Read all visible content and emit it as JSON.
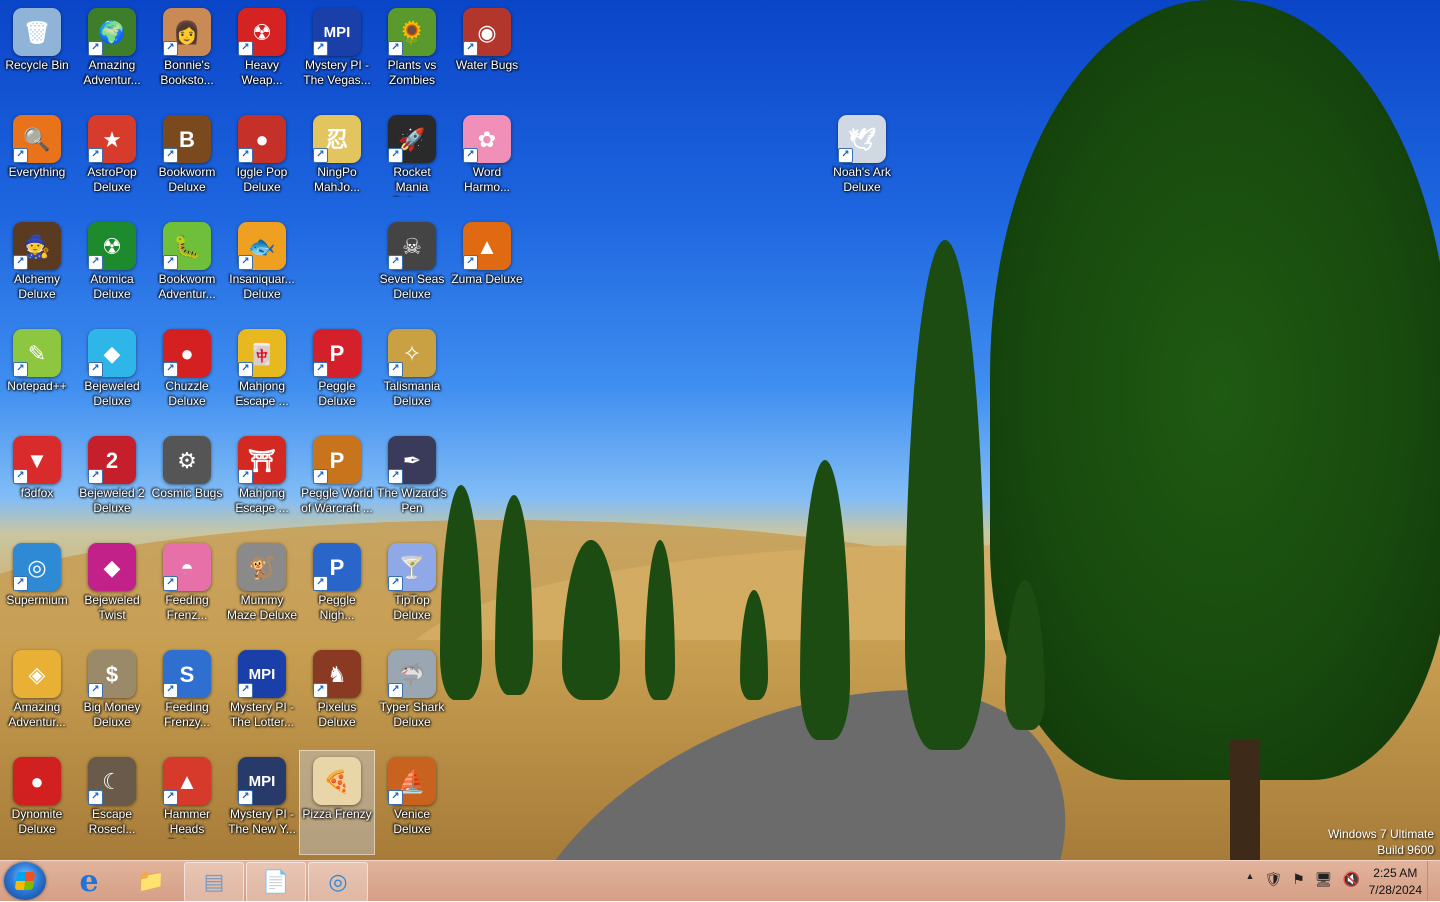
{
  "desktop": {
    "icons": [
      {
        "label": "Recycle Bin",
        "name": "recycle-bin-icon",
        "glyph": "🗑",
        "color": "#8fb4d8",
        "shortcut": false
      },
      {
        "label": "Amazing Adventur...",
        "name": "amazing-adventures-icon",
        "glyph": "🌍",
        "color": "#3e7d2a",
        "shortcut": true
      },
      {
        "label": "Bonnie's Booksto...",
        "name": "bonnies-bookstore-icon",
        "glyph": "👩",
        "color": "#c98a55",
        "shortcut": true
      },
      {
        "label": "Heavy Weap...",
        "name": "heavy-weapon-icon",
        "glyph": "☢",
        "color": "#d52222",
        "shortcut": true
      },
      {
        "label": "Mystery PI - The Vegas...",
        "name": "mystery-pi-vegas-icon",
        "glyph": "MPI",
        "color": "#1b3fa8",
        "shortcut": true
      },
      {
        "label": "Plants vs Zombies",
        "name": "plants-vs-zombies-icon",
        "glyph": "🌻",
        "color": "#5a9a2c",
        "shortcut": true
      },
      {
        "label": "Water Bugs",
        "name": "water-bugs-icon",
        "glyph": "◉",
        "color": "#b3362c",
        "shortcut": true
      },
      {
        "label": "Everything",
        "name": "everything-icon",
        "glyph": "🔍",
        "color": "#e8731a",
        "shortcut": true
      },
      {
        "label": "AstroPop Deluxe",
        "name": "astropop-deluxe-icon",
        "glyph": "★",
        "color": "#d63b2b",
        "shortcut": true
      },
      {
        "label": "Bookworm Deluxe",
        "name": "bookworm-deluxe-icon",
        "glyph": "B",
        "color": "#7a4a1e",
        "shortcut": true
      },
      {
        "label": "Iggle Pop Deluxe",
        "name": "iggle-pop-deluxe-icon",
        "glyph": "●",
        "color": "#c53028",
        "shortcut": true
      },
      {
        "label": "NingPo MahJo...",
        "name": "ningpo-mahjong-icon",
        "glyph": "忍",
        "color": "#e3c560",
        "shortcut": true
      },
      {
        "label": "Rocket Mania Deluxe",
        "name": "rocket-mania-deluxe-icon",
        "glyph": "🚀",
        "color": "#2a2a2a",
        "shortcut": true
      },
      {
        "label": "Word Harmo...",
        "name": "word-harmony-icon",
        "glyph": "✿",
        "color": "#f08fb8",
        "shortcut": true
      },
      {
        "label": "Alchemy Deluxe",
        "name": "alchemy-deluxe-icon",
        "glyph": "🧙",
        "color": "#5b3a22",
        "shortcut": true
      },
      {
        "label": "Atomica Deluxe",
        "name": "atomica-deluxe-icon",
        "glyph": "☢",
        "color": "#1d8a2e",
        "shortcut": true
      },
      {
        "label": "Bookworm Adventur...",
        "name": "bookworm-adventures-icon",
        "glyph": "🐛",
        "color": "#6fbf3a",
        "shortcut": true
      },
      {
        "label": "Insaniquar... Deluxe",
        "name": "insaniquarium-deluxe-icon",
        "glyph": "🐟",
        "color": "#f0a020",
        "shortcut": true
      },
      {
        "label": "Seven Seas Deluxe",
        "name": "seven-seas-deluxe-icon",
        "glyph": "☠",
        "color": "#444444",
        "shortcut": true
      },
      {
        "label": "Zuma Deluxe",
        "name": "zuma-deluxe-icon",
        "glyph": "▲",
        "color": "#e06a12",
        "shortcut": true
      },
      {
        "label": "Notepad++",
        "name": "notepad-plus-plus-icon",
        "glyph": "✎",
        "color": "#8dc63f",
        "shortcut": true
      },
      {
        "label": "Bejeweled Deluxe",
        "name": "bejeweled-deluxe-icon",
        "glyph": "◆",
        "color": "#2fb6e8",
        "shortcut": true
      },
      {
        "label": "Chuzzle Deluxe",
        "name": "chuzzle-deluxe-icon",
        "glyph": "●",
        "color": "#d42020",
        "shortcut": true
      },
      {
        "label": "Mahjong Escape ...",
        "name": "mahjong-escape-icon-1",
        "glyph": "🀄",
        "color": "#e8b820",
        "shortcut": true
      },
      {
        "label": "Peggle Deluxe",
        "name": "peggle-deluxe-icon",
        "glyph": "P",
        "color": "#d4202a",
        "shortcut": true
      },
      {
        "label": "Talismania Deluxe",
        "name": "talismania-deluxe-icon",
        "glyph": "✧",
        "color": "#c9a042",
        "shortcut": true
      },
      {
        "label": "f3dfox",
        "name": "f3dfox-icon",
        "glyph": "▼",
        "color": "#d92b2b",
        "shortcut": true
      },
      {
        "label": "Bejeweled 2 Deluxe",
        "name": "bejeweled-2-deluxe-icon",
        "glyph": "2",
        "color": "#c41f2a",
        "shortcut": true
      },
      {
        "label": "Cosmic Bugs",
        "name": "cosmic-bugs-icon",
        "glyph": "⚙",
        "color": "#555555",
        "shortcut": false
      },
      {
        "label": "Mahjong Escape ...",
        "name": "mahjong-escape-icon-2",
        "glyph": "⛩",
        "color": "#d22a22",
        "shortcut": true
      },
      {
        "label": "Peggle World of Warcraft ...",
        "name": "peggle-wow-icon",
        "glyph": "P",
        "color": "#c7741c",
        "shortcut": true
      },
      {
        "label": "The Wizard's Pen",
        "name": "wizards-pen-icon",
        "glyph": "✒",
        "color": "#3a3a5a",
        "shortcut": true
      },
      {
        "label": "Supermium",
        "name": "supermium-icon",
        "glyph": "◎",
        "color": "#2f8ad6",
        "shortcut": true
      },
      {
        "label": "Bejeweled Twist",
        "name": "bejeweled-twist-icon",
        "glyph": "◆",
        "color": "#c3218a",
        "shortcut": false
      },
      {
        "label": "Feeding Frenz...",
        "name": "feeding-frenzy-icon",
        "glyph": "◓",
        "color": "#e870a8",
        "shortcut": true
      },
      {
        "label": "Mummy Maze Deluxe",
        "name": "mummy-maze-deluxe-icon",
        "glyph": "🐒",
        "color": "#8a8a8a",
        "shortcut": false
      },
      {
        "label": "Peggle Nigh...",
        "name": "peggle-nights-icon",
        "glyph": "P",
        "color": "#2a66c9",
        "shortcut": true
      },
      {
        "label": "TipTop Deluxe",
        "name": "tiptop-deluxe-icon",
        "glyph": "🍸",
        "color": "#8fa8e8",
        "shortcut": true
      },
      {
        "label": "Amazing Adventur...",
        "name": "amazing-adventures-2-icon",
        "glyph": "◈",
        "color": "#e8b035",
        "shortcut": false
      },
      {
        "label": "Big Money Deluxe",
        "name": "big-money-deluxe-icon",
        "glyph": "$",
        "color": "#9b8a6a",
        "shortcut": true
      },
      {
        "label": "Feeding Frenzy...",
        "name": "feeding-frenzy-2-icon",
        "glyph": "S",
        "color": "#2f6fd0",
        "shortcut": true
      },
      {
        "label": "Mystery PI - The Lotter...",
        "name": "mystery-pi-lottery-icon",
        "glyph": "MPI",
        "color": "#1b3fa8",
        "shortcut": true
      },
      {
        "label": "Pixelus Deluxe",
        "name": "pixelus-deluxe-icon",
        "glyph": "♞",
        "color": "#8a3a22",
        "shortcut": true
      },
      {
        "label": "Typer Shark Deluxe",
        "name": "typer-shark-deluxe-icon",
        "glyph": "🦈",
        "color": "#9aa7b3",
        "shortcut": true
      },
      {
        "label": "Dynomite Deluxe",
        "name": "dynomite-deluxe-icon",
        "glyph": "●",
        "color": "#d21f1f",
        "shortcut": false
      },
      {
        "label": "Escape Rosecl...",
        "name": "escape-rosecliff-icon",
        "glyph": "☾",
        "color": "#6a5a4a",
        "shortcut": true
      },
      {
        "label": "Hammer Heads Deluxe",
        "name": "hammer-heads-deluxe-icon",
        "glyph": "▲",
        "color": "#d63a2a",
        "shortcut": true
      },
      {
        "label": "Mystery PI - The New Y...",
        "name": "mystery-pi-new-york-icon",
        "glyph": "MPI",
        "color": "#283a6a",
        "shortcut": true
      },
      {
        "label": "Pizza Frenzy",
        "name": "pizza-frenzy-icon",
        "glyph": "🍕",
        "color": "#e8d6a8",
        "shortcut": false
      },
      {
        "label": "Venice Deluxe",
        "name": "venice-deluxe-icon",
        "glyph": "⛵",
        "color": "#c8621e",
        "shortcut": true
      },
      {
        "label": "Noah's Ark Deluxe",
        "name": "noahs-ark-deluxe-icon",
        "glyph": "🕊",
        "color": "#cfd8e3",
        "shortcut": true
      }
    ],
    "watermark_line1": "Windows 7 Ultimate",
    "watermark_line2": "Build 9600"
  },
  "taskbar": {
    "buttons": [
      {
        "name": "internet-explorer-icon",
        "glyph": "e",
        "color": "#1e74d8"
      },
      {
        "name": "file-explorer-icon",
        "glyph": "📁",
        "color": "#e8c25a"
      },
      {
        "name": "control-panel-icon",
        "glyph": "▤",
        "color": "#7a9cc0"
      },
      {
        "name": "notepad-icon",
        "glyph": "📄",
        "color": "#ffffff"
      },
      {
        "name": "supermium-taskbar-icon",
        "glyph": "◎",
        "color": "#2f8ad6"
      }
    ],
    "tray": [
      {
        "name": "show-hidden-icons-chevron-icon",
        "glyph": "▲"
      },
      {
        "name": "security-shield-icon",
        "glyph": "🛡"
      },
      {
        "name": "action-center-flag-icon",
        "glyph": "⚑"
      },
      {
        "name": "network-icon",
        "glyph": "🖥"
      },
      {
        "name": "volume-muted-icon",
        "glyph": "🔇"
      }
    ],
    "clock_time": "2:25 AM",
    "clock_date": "7/28/2024"
  }
}
